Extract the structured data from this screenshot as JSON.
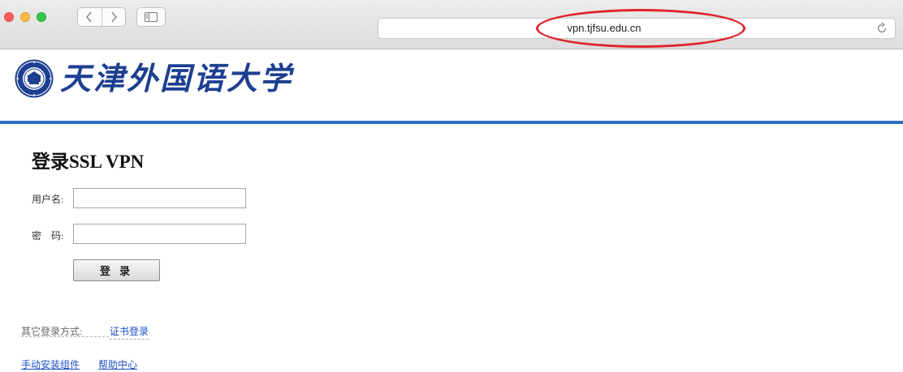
{
  "browser": {
    "url": "vpn.tjfsu.edu.cn",
    "icons": {
      "back": "chevron-left-icon",
      "forward": "chevron-right-icon",
      "sidebar": "sidebar-icon",
      "reload": "reload-icon"
    },
    "annotation_color": "#e0242a"
  },
  "header": {
    "university_name": "天津外国语大学",
    "seal_text": "TIANJIN FOREIGN STUDIES UNIVERSITY",
    "brand_color": "#1d3f91",
    "rule_color": "#2b6fc1"
  },
  "login": {
    "title": "登录SSL VPN",
    "username_label": "用户名:",
    "password_label": "密　码:",
    "username_value": "",
    "password_value": "",
    "submit_label": "登 录"
  },
  "alternatives": {
    "label": "其它登录方式:",
    "cert_login": "证书登录"
  },
  "footer_links": {
    "manual_install": "手动安装组件",
    "help_center": "帮助中心"
  }
}
